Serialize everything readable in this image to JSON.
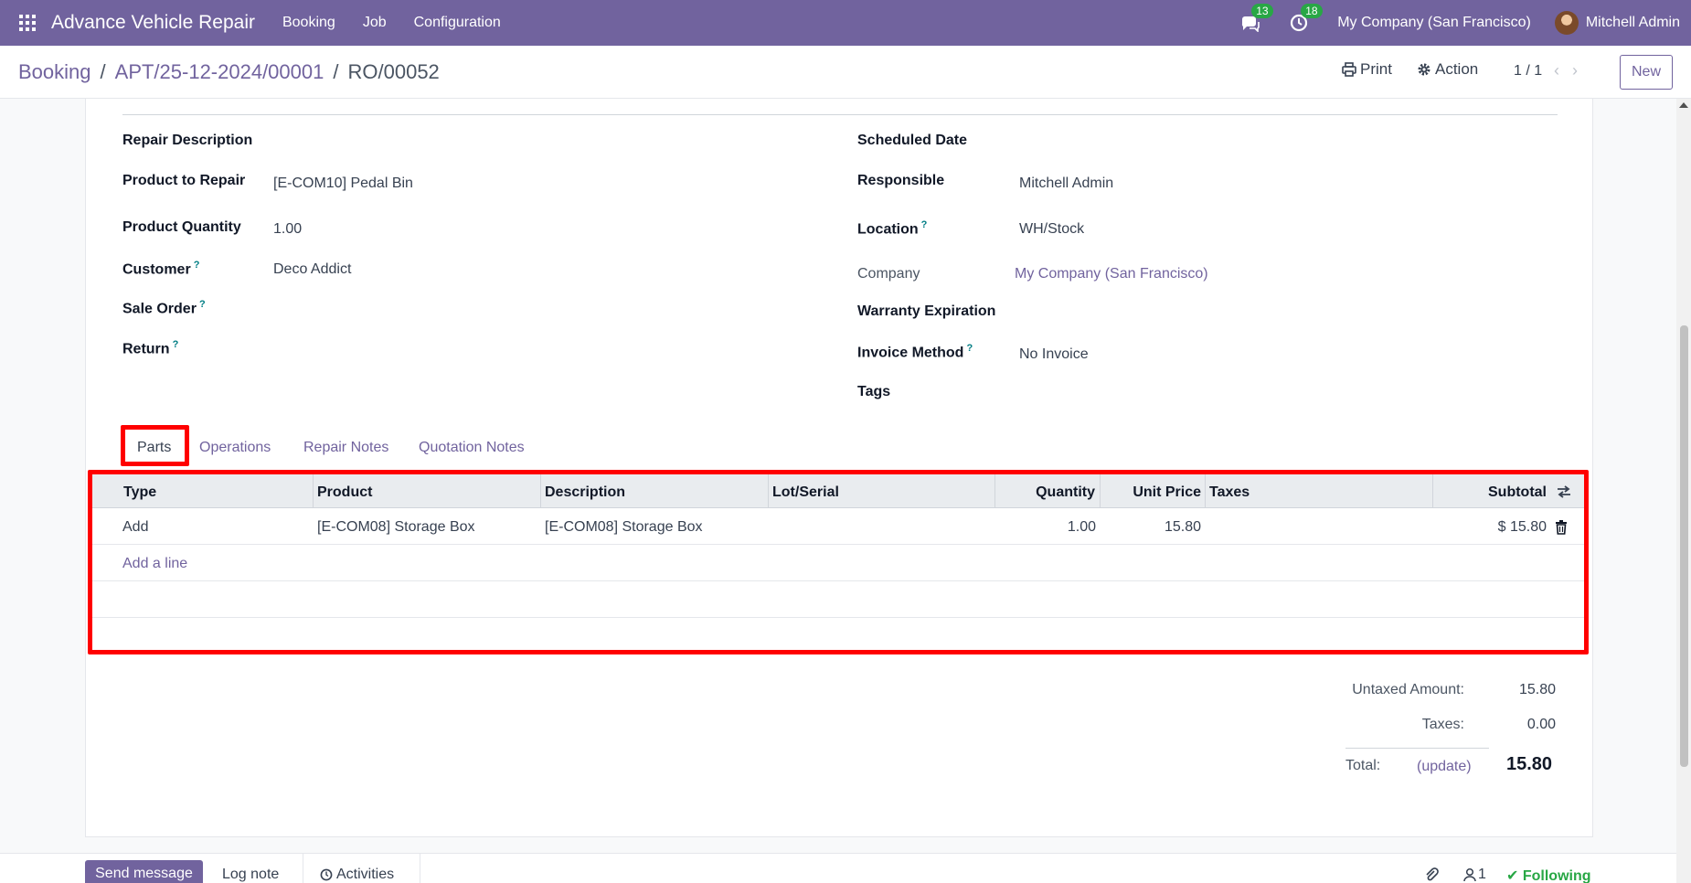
{
  "navbar": {
    "app_title": "Advance Vehicle Repair",
    "menu": [
      "Booking",
      "Job",
      "Configuration"
    ],
    "messages_count": "13",
    "activities_count": "18",
    "company": "My Company (San Francisco)",
    "user": "Mitchell Admin",
    "color": "#71639e"
  },
  "breadcrumb": {
    "items": [
      "Booking",
      "APT/25-12-2024/00001"
    ],
    "current": "RO/00052",
    "separator": "/"
  },
  "control": {
    "print": "Print",
    "action": "Action",
    "pager": "1 / 1",
    "new": "New"
  },
  "form": {
    "left": {
      "repair_description": "Repair Description",
      "product_to_repair_label": "Product to Repair",
      "product_to_repair": "[E-COM10] Pedal Bin",
      "product_quantity_label": "Product Quantity",
      "product_quantity": "1.00",
      "customer_label": "Customer",
      "customer": "Deco Addict",
      "sale_order_label": "Sale Order",
      "return_label": "Return"
    },
    "right": {
      "scheduled_date_label": "Scheduled Date",
      "responsible_label": "Responsible",
      "responsible": "Mitchell Admin",
      "location_label": "Location",
      "location": "WH/Stock",
      "company_label": "Company",
      "company": "My Company (San Francisco)",
      "warranty_label": "Warranty Expiration",
      "invoice_method_label": "Invoice Method",
      "invoice_method": "No Invoice",
      "tags_label": "Tags"
    },
    "help_mark": "?"
  },
  "tabs": {
    "parts": "Parts",
    "operations": "Operations",
    "repair_notes": "Repair Notes",
    "quotation_notes": "Quotation Notes",
    "active": "Parts"
  },
  "parts_table": {
    "headers": {
      "type": "Type",
      "product": "Product",
      "description": "Description",
      "lot": "Lot/Serial",
      "quantity": "Quantity",
      "unit_price": "Unit Price",
      "taxes": "Taxes",
      "subtotal": "Subtotal"
    },
    "rows": [
      {
        "type": "Add",
        "product": "[E-COM08] Storage Box",
        "description": "[E-COM08] Storage Box",
        "lot": "",
        "quantity": "1.00",
        "unit_price": "15.80",
        "taxes": "",
        "subtotal": "$ 15.80"
      }
    ],
    "add_line": "Add a line"
  },
  "totals": {
    "untaxed_label": "Untaxed Amount:",
    "untaxed": "15.80",
    "taxes_label": "Taxes:",
    "taxes": "0.00",
    "total_label": "Total:",
    "update": "(update)",
    "total": "15.80"
  },
  "chatter": {
    "send_message": "Send message",
    "log_note": "Log note",
    "activities": "Activities",
    "followers_count": "1",
    "following": "Following"
  },
  "highlight_color": "#ff0000"
}
